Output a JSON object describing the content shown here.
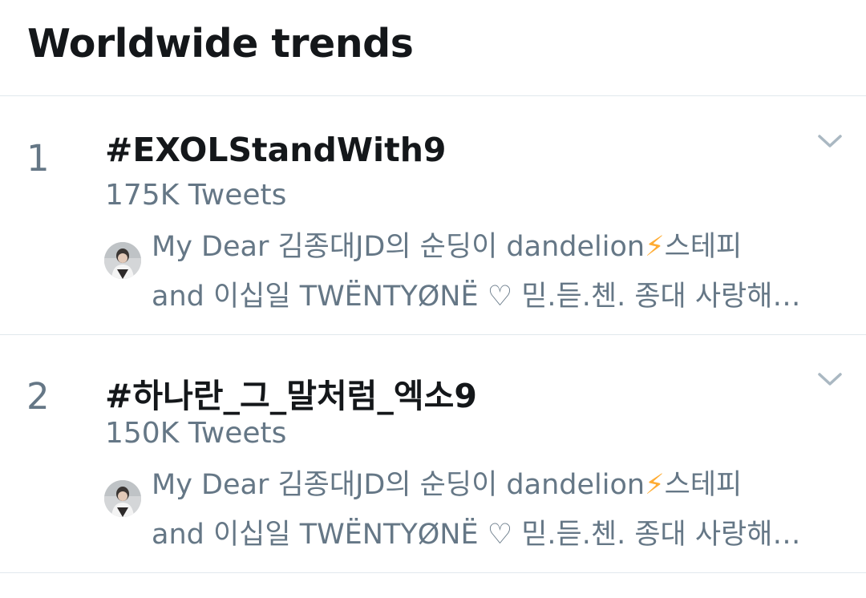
{
  "header": {
    "title": "Worldwide trends"
  },
  "trends": [
    {
      "rank": "1",
      "name": "#EXOLStandWith9",
      "tweet_count": "175K Tweets",
      "context_line1_before": "My Dear 김종대JD의 순딩이 dandelion",
      "context_line1_emoji": "⚡",
      "context_line1_after": "스테피",
      "context_line2": "and 이십일 TWËNTYØNË ♡ 믿.듣.첸. 종대 사랑해…",
      "avatar_icon": "profile-photo",
      "menu_icon": "chevron-down-icon"
    },
    {
      "rank": "2",
      "name": "#하나란_그_말처럼_엑소9",
      "tweet_count": "150K Tweets",
      "context_line1_before": "My Dear 김종대JD의 순딩이 dandelion",
      "context_line1_emoji": "⚡",
      "context_line1_after": "스테피",
      "context_line2": "and 이십일 TWËNTYØNË ♡ 믿.듣.첸. 종대 사랑해…",
      "avatar_icon": "profile-photo",
      "menu_icon": "chevron-down-icon"
    }
  ],
  "colors": {
    "primary_text": "#14171a",
    "secondary_text": "#657786",
    "divider": "#e1e8ed",
    "chevron": "#aab8c2",
    "emoji_bolt": "#ffac33"
  }
}
